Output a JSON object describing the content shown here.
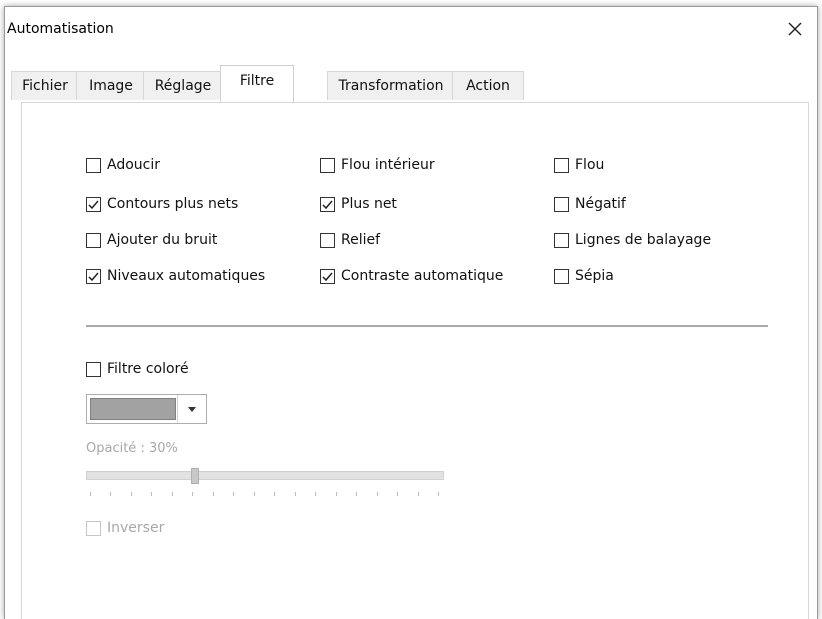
{
  "window": {
    "title": "Automatisation",
    "close_icon": "close-icon",
    "close_glyph": "✕"
  },
  "tabs": [
    {
      "label": "Fichier",
      "active": false
    },
    {
      "label": "Image",
      "active": false
    },
    {
      "label": "Réglage",
      "active": false
    },
    {
      "label": "Filtre",
      "active": true
    },
    {
      "label": "Transformation",
      "active": false
    },
    {
      "label": "Action",
      "active": false
    }
  ],
  "filters": [
    {
      "label": "Adoucir",
      "checked": false
    },
    {
      "label": "Flou intérieur",
      "checked": false
    },
    {
      "label": "Flou",
      "checked": false
    },
    {
      "label": "Contours plus nets",
      "checked": true
    },
    {
      "label": "Plus net",
      "checked": true
    },
    {
      "label": "Négatif",
      "checked": false
    },
    {
      "label": "Ajouter du bruit",
      "checked": false
    },
    {
      "label": "Relief",
      "checked": false
    },
    {
      "label": "Lignes de balayage",
      "checked": false
    },
    {
      "label": "Niveaux automatiques",
      "checked": true
    },
    {
      "label": "Contraste automatique",
      "checked": true
    },
    {
      "label": "Sépia",
      "checked": false
    }
  ],
  "color_filter": {
    "label": "Filtre coloré",
    "checked": false,
    "swatch_color": "#a2a2a2",
    "dropdown_icon": "chevron-down-icon",
    "opacity_label": "Opacité : 30%",
    "opacity_value": 30,
    "tick_count": 18,
    "invert_label": "Inverser",
    "invert_checked": false,
    "invert_disabled": true
  }
}
